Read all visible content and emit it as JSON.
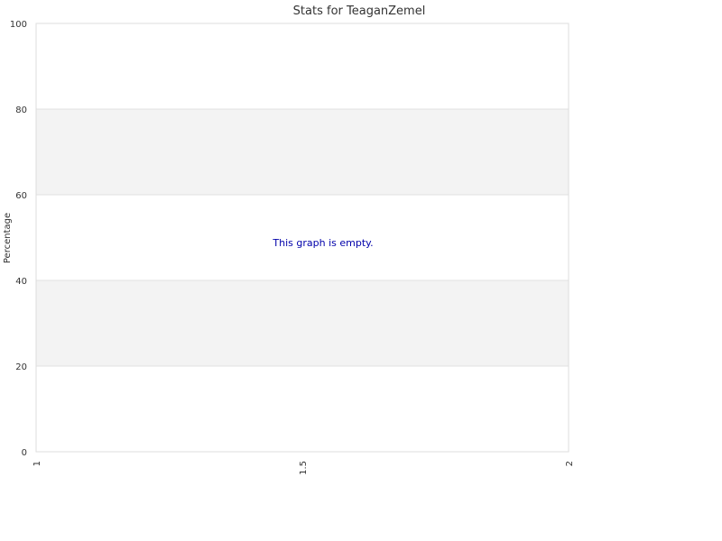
{
  "chart_data": {
    "type": "line",
    "title": "Stats for TeaganZemel",
    "xlabel": "",
    "ylabel": "Percentage",
    "ylim": [
      0,
      100
    ],
    "xlim": [
      1,
      2
    ],
    "y_ticks": [
      0,
      20,
      40,
      60,
      80,
      100
    ],
    "x_ticks": [
      "1",
      "1.5",
      "2"
    ],
    "series": [],
    "grid": true,
    "legend": "none",
    "empty_message": "This graph is empty."
  },
  "colors": {
    "band_light": "#f3f3f3",
    "band_white": "#ffffff",
    "plot_border": "#dddddd",
    "gridline": "#e0e0e0",
    "title_text": "#333333",
    "tick_text": "#333333",
    "empty_text": "#0000aa"
  }
}
